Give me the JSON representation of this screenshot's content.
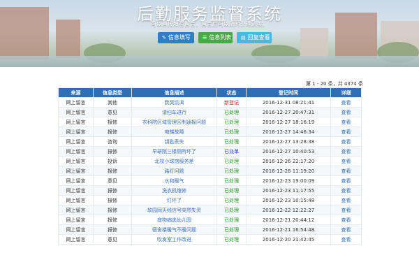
{
  "header": {
    "title": "后勤服务监督系统",
    "subtitle": "可以直接填写留言，留言后可以随时处理进度。",
    "buttons": [
      {
        "label": "信息填写",
        "icon": "pencil-icon",
        "color": "#2f7ec8"
      },
      {
        "label": "信息列表",
        "icon": "list-icon",
        "color": "#49a84a"
      },
      {
        "label": "回复查看",
        "icon": "reply-icon",
        "color": "#4bb8de"
      }
    ]
  },
  "pagination": {
    "text": "第 1 - 20 条，共 4374 条"
  },
  "table": {
    "columns": [
      "来源",
      "信息类型",
      "信息描述",
      "状态",
      "登记时间",
      "详细"
    ],
    "rows": [
      [
        "网上留言",
        "其他",
        "我哭饥渴",
        "新登记",
        "2016-12-31 08:21:41",
        "查看"
      ],
      [
        "网上留言",
        "意见",
        "请扫车进行",
        "已处理",
        "2016-12-27 20:47:31",
        "查看"
      ],
      [
        "网上留言",
        "报修",
        "农科院区域管理区制通报问题",
        "已处理",
        "2016-12-27 18:16:19",
        "查看"
      ],
      [
        "网上留言",
        "报修",
        "电梯故障",
        "已处理",
        "2016-12-27 14:46:34",
        "查看"
      ],
      [
        "网上留言",
        "咨询",
        "钥匙丢失",
        "已处理",
        "2016-12-27 13:28:38",
        "查看"
      ],
      [
        "网上留言",
        "报修",
        "早研院三楼厕所坏了",
        "已派单",
        "2016-12-27 10:40:53",
        "查看"
      ],
      [
        "网上留言",
        "投诉",
        "北校小球馆服务差",
        "已处理",
        "2016-12-26 22:17:20",
        "查看"
      ],
      [
        "网上留言",
        "报修",
        "路灯问题",
        "已处理",
        "2016-12-26 11:19:20",
        "查看"
      ],
      [
        "网上留言",
        "意见",
        "水和暖气",
        "已处理",
        "2016-12-23 19:00:09",
        "查看"
      ],
      [
        "网上留言",
        "报修",
        "洗衣机维修",
        "已处理",
        "2016-12-23 11:17:55",
        "查看"
      ],
      [
        "网上留言",
        "报修",
        "灯坏了",
        "已处理",
        "2016-12-23 10:15:48",
        "查看"
      ],
      [
        "网上留言",
        "报修",
        "软园同天线信号突然失灵",
        "已处理",
        "2016-12-22 12:22:27",
        "查看"
      ],
      [
        "网上留言",
        "报修",
        "宠物病逃幼儿园",
        "已处理",
        "2016-12-21 20:44:12",
        "查看"
      ],
      [
        "网上留言",
        "报修",
        "宿舍楼暖气不暖问题",
        "已处理",
        "2016-12-21 16:54:48",
        "查看"
      ],
      [
        "网上留言",
        "意见",
        "吹发室工作改进",
        "已处理",
        "2016-12-20 21:42:45",
        "查看"
      ]
    ],
    "status_colors": {
      "新登记": "#e02020",
      "已处理": "#1b9a1b",
      "已派单": "#1f3bd0"
    }
  }
}
